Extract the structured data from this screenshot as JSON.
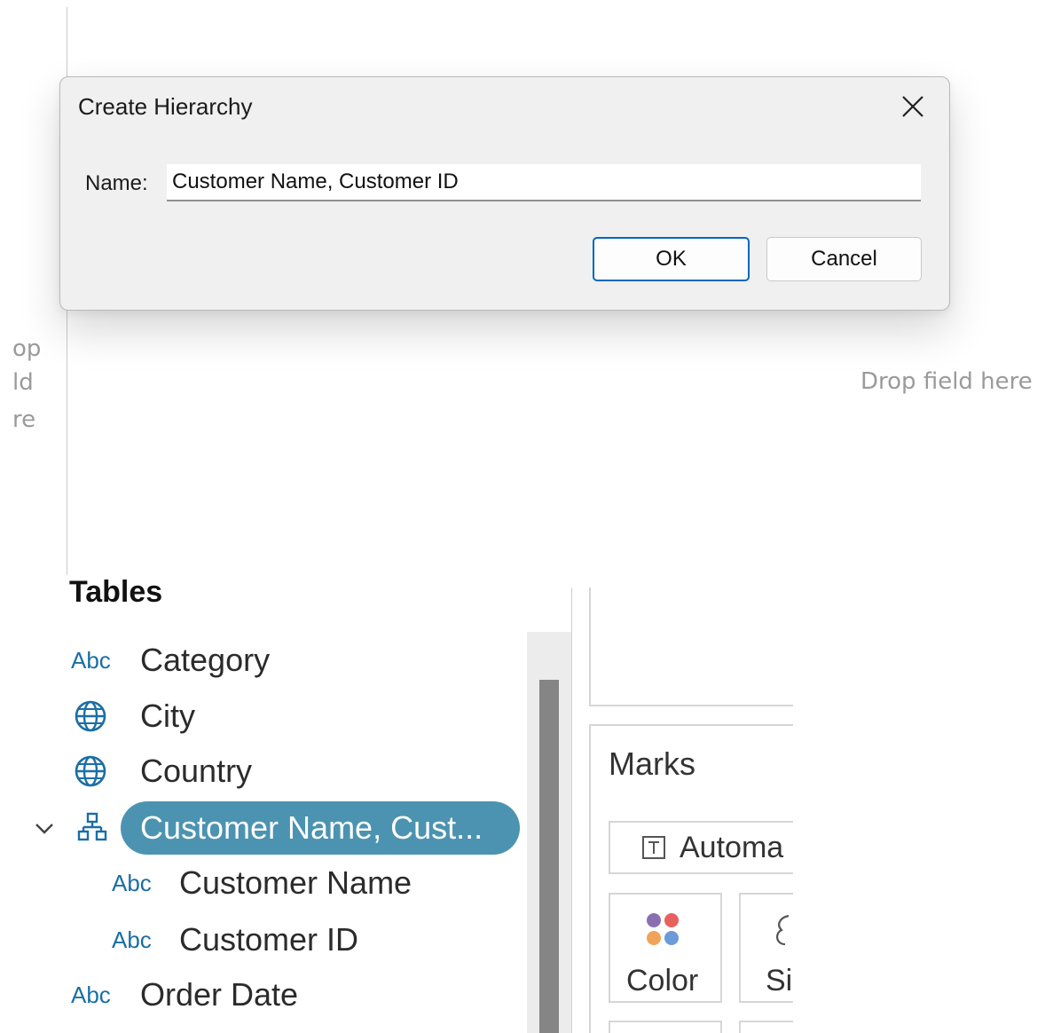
{
  "dialog": {
    "title": "Create Hierarchy",
    "name_label": "Name:",
    "name_value": "Customer Name, Customer ID",
    "ok_label": "OK",
    "cancel_label": "Cancel",
    "close_icon": "close-icon"
  },
  "canvas": {
    "drop_left_fragments": [
      "op",
      "ld",
      "re"
    ],
    "drop_right": "Drop field here"
  },
  "data_pane": {
    "header": "Tables",
    "fields": [
      {
        "icon": "abc-icon",
        "icon_text": "Abc",
        "label": "Category"
      },
      {
        "icon": "globe-icon",
        "label": "City"
      },
      {
        "icon": "globe-icon",
        "label": "Country"
      },
      {
        "icon": "hierarchy-icon",
        "label": "Customer Name, Cust...",
        "selected": true,
        "expanded": true
      },
      {
        "icon": "abc-icon",
        "icon_text": "Abc",
        "label": "Customer Name",
        "indent": true
      },
      {
        "icon": "abc-icon",
        "icon_text": "Abc",
        "label": "Customer ID",
        "indent": true
      },
      {
        "icon": "abc-icon",
        "icon_text": "Abc",
        "label": "Order Date"
      }
    ]
  },
  "marks": {
    "title": "Marks",
    "type_label": "Automa",
    "cards": [
      {
        "label": "Color",
        "icon": "color-dots-icon"
      },
      {
        "label": "Si",
        "icon": "size-icon"
      }
    ]
  },
  "colors": {
    "pill": "#4b93b1",
    "abc": "#1a6ea6",
    "ok_border": "#0067c0",
    "dot_purple": "#8a6fb0",
    "dot_red": "#e8615f",
    "dot_orange": "#f2a35a",
    "dot_blue": "#6b9bd8"
  }
}
